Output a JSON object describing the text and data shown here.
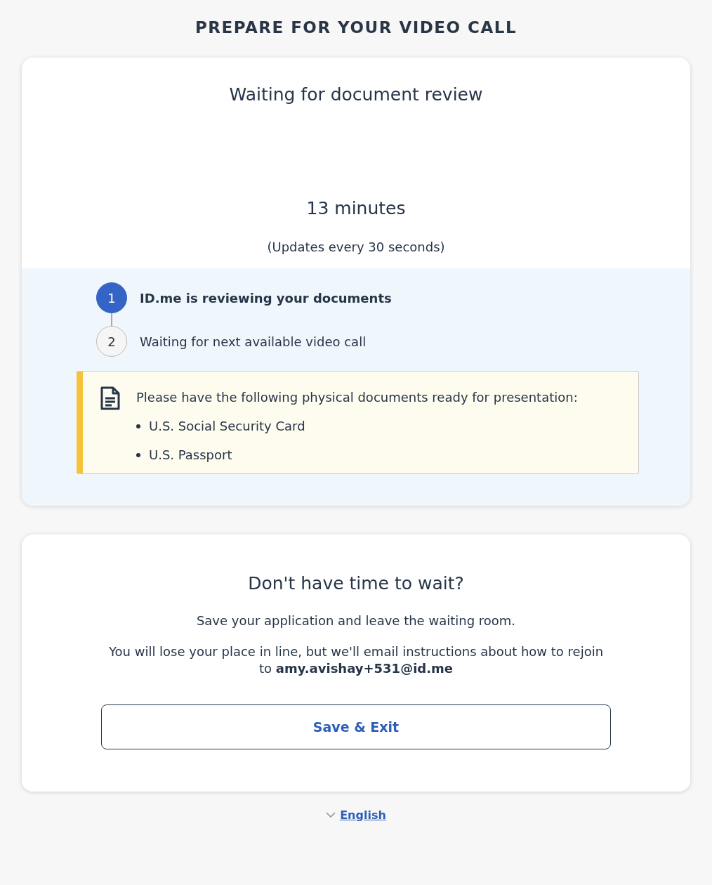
{
  "page_title": "PREPARE FOR YOUR VIDEO CALL",
  "status_card": {
    "title": "Waiting for document review",
    "wait_time": "13 minutes",
    "update_note": "(Updates every 30 seconds)",
    "steps": [
      {
        "number": "1",
        "label": "ID.me is reviewing your documents",
        "active": true
      },
      {
        "number": "2",
        "label": "Waiting for next available video call",
        "active": false
      }
    ],
    "notice": {
      "text": "Please have the following physical documents ready for presentation:",
      "items": [
        "U.S. Social Security Card",
        "U.S. Passport"
      ]
    }
  },
  "exit_card": {
    "title": "Don't have time to wait?",
    "text": "Save your application and leave the waiting room.",
    "detail": "You will lose your place in line, but we'll email instructions about how to rejoin to **amy.avishay+531@id.me**",
    "button": "Save & Exit"
  },
  "language": "English"
}
